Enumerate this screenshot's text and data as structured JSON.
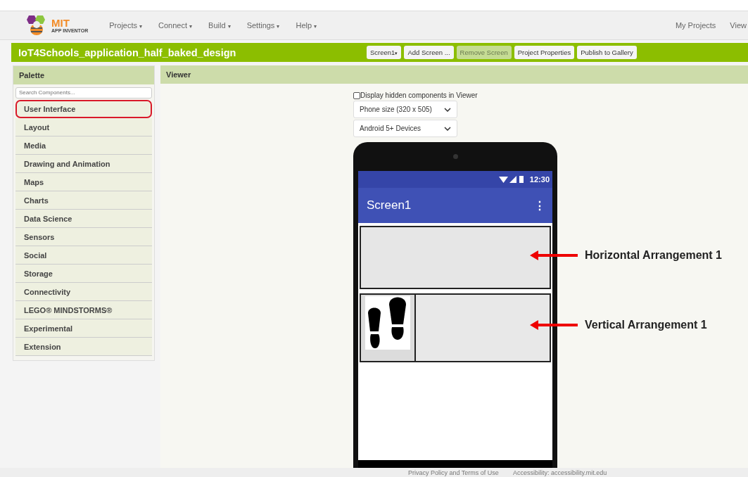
{
  "top_nav": {
    "logo_line1": "MIT",
    "logo_line2": "APP INVENTOR",
    "menus": [
      {
        "label": "Projects",
        "caret": "▾"
      },
      {
        "label": "Connect",
        "caret": "▾"
      },
      {
        "label": "Build",
        "caret": "▾"
      },
      {
        "label": "Settings",
        "caret": "▾"
      },
      {
        "label": "Help",
        "caret": "▾"
      }
    ],
    "right_links": [
      "My Projects",
      "View"
    ]
  },
  "project_bar": {
    "title": "IoT4Schools_application_half_baked_design",
    "buttons": [
      {
        "label": "Screen1",
        "caret": "▾",
        "disabled": false
      },
      {
        "label": "Add Screen ...",
        "disabled": false
      },
      {
        "label": "Remove Screen",
        "disabled": true
      },
      {
        "label": "Project Properties",
        "disabled": false
      },
      {
        "label": "Publish to Gallery",
        "disabled": false
      }
    ]
  },
  "palette": {
    "title": "Palette",
    "search": {
      "placeholder": "Search Components..."
    },
    "items": [
      {
        "label": "User Interface",
        "highlighted": true
      },
      {
        "label": "Layout",
        "highlighted": false
      },
      {
        "label": "Media",
        "highlighted": false
      },
      {
        "label": "Drawing and Animation",
        "highlighted": false
      },
      {
        "label": "Maps",
        "highlighted": false
      },
      {
        "label": "Charts",
        "highlighted": false
      },
      {
        "label": "Data Science",
        "highlighted": false
      },
      {
        "label": "Sensors",
        "highlighted": false
      },
      {
        "label": "Social",
        "highlighted": false
      },
      {
        "label": "Storage",
        "highlighted": false
      },
      {
        "label": "Connectivity",
        "highlighted": false
      },
      {
        "label": "LEGO® MINDSTORMS®",
        "highlighted": false
      },
      {
        "label": "Experimental",
        "highlighted": false
      },
      {
        "label": "Extension",
        "highlighted": false
      }
    ]
  },
  "viewer": {
    "title": "Viewer",
    "hidden_components": {
      "label": "Display hidden components in Viewer",
      "checked": false
    },
    "size_select": "Phone size (320 x 505)",
    "device_select": "Android 5+ Devices",
    "phone": {
      "time": "12:30",
      "screen_title": "Screen1",
      "menu_glyph": "⋮"
    },
    "annotations": [
      "Horizontal Arrangement 1",
      "Vertical Arrangement 1"
    ]
  },
  "footer": [
    "Privacy Policy and Terms of Use",
    "Accessibility: accessibility.mit.edu"
  ]
}
